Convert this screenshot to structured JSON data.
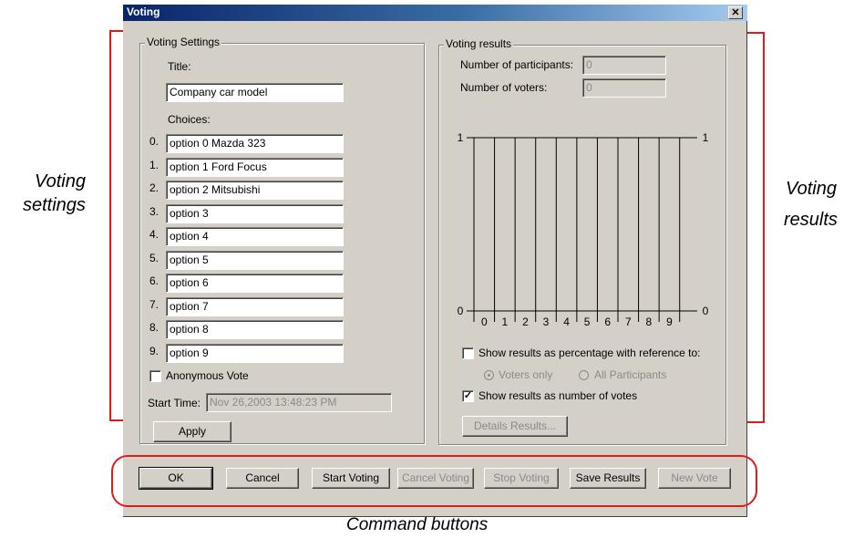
{
  "window": {
    "title": "Voting",
    "close_glyph": "✕"
  },
  "settings": {
    "group_label": "Voting Settings",
    "title_label": "Title:",
    "title_value": "Company car model",
    "choices_label": "Choices:",
    "choices": [
      {
        "num": "0.",
        "value": "option 0 Mazda 323"
      },
      {
        "num": "1.",
        "value": "option 1 Ford Focus"
      },
      {
        "num": "2.",
        "value": "option 2 Mitsubishi"
      },
      {
        "num": "3.",
        "value": "option 3"
      },
      {
        "num": "4.",
        "value": "option 4"
      },
      {
        "num": "5.",
        "value": "option 5"
      },
      {
        "num": "6.",
        "value": "option 6"
      },
      {
        "num": "7.",
        "value": "option 7"
      },
      {
        "num": "8.",
        "value": "option 8"
      },
      {
        "num": "9.",
        "value": "option 9"
      }
    ],
    "anonymous_label": "Anonymous Vote",
    "anonymous_checked": false,
    "start_time_label": "Start Time:",
    "start_time_value": "Nov 26,2003  13:48:23 PM",
    "apply_label": "Apply"
  },
  "results": {
    "group_label": "Voting results",
    "participants_label": "Number of participants:",
    "participants_value": "0",
    "voters_label": "Number of voters:",
    "voters_value": "0",
    "percentage_label": "Show results as percentage with reference to:",
    "percentage_checked": false,
    "voters_only_label": "Voters only",
    "all_participants_label": "All Participants",
    "number_label": "Show results as number of votes",
    "number_checked": true,
    "details_label": "Details Results..."
  },
  "chart_data": {
    "type": "bar",
    "categories": [
      "0",
      "1",
      "2",
      "3",
      "4",
      "5",
      "6",
      "7",
      "8",
      "9"
    ],
    "values": [
      0,
      0,
      0,
      0,
      0,
      0,
      0,
      0,
      0,
      0
    ],
    "ylim": [
      0,
      1
    ],
    "yticks_left": [
      "1",
      "0"
    ],
    "yticks_right": [
      "1",
      "0"
    ]
  },
  "commands": {
    "ok": "OK",
    "cancel": "Cancel",
    "start": "Start Voting",
    "cancel_voting": "Cancel Voting",
    "stop": "Stop Voting",
    "save": "Save Results",
    "new": "New Vote"
  },
  "annotations": {
    "settings_line1": "Voting",
    "settings_line2": "settings",
    "results_line1": "Voting",
    "results_line2": "results",
    "command_buttons": "Command buttons",
    "accent": "#e01b1b"
  }
}
